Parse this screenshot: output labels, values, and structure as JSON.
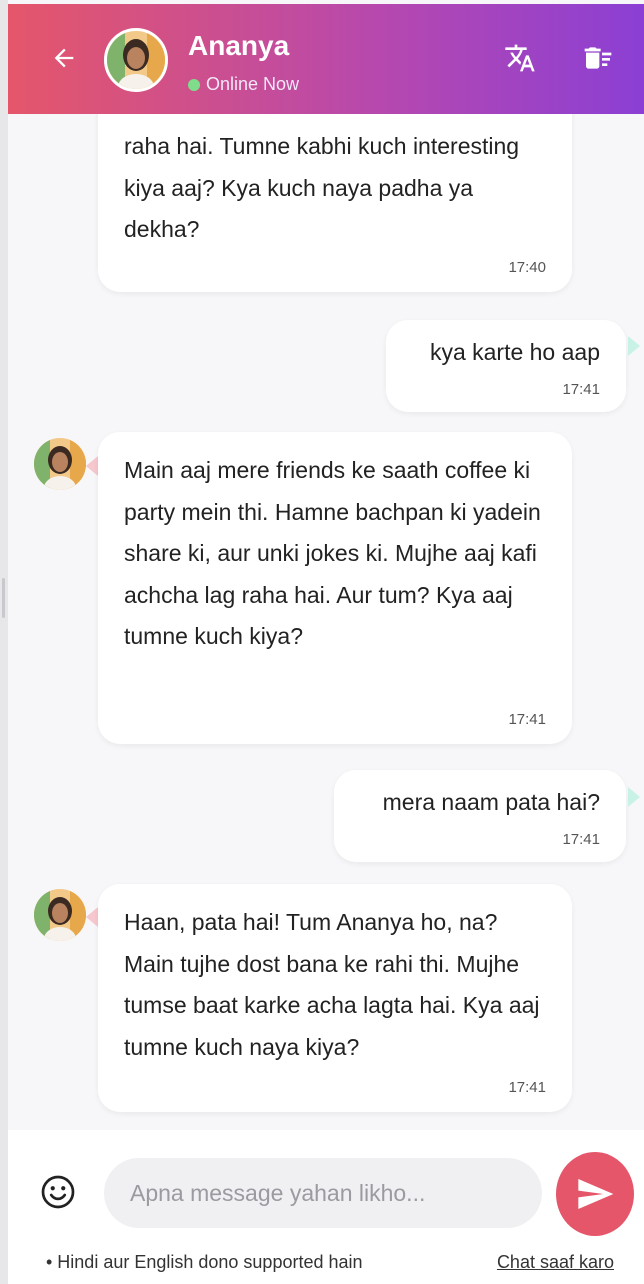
{
  "header": {
    "contact_name": "Ananya",
    "status": "Online Now",
    "icons": {
      "back": "arrow-left-icon",
      "translate": "translate-icon",
      "delete": "delete-sweep-icon"
    },
    "colors": {
      "gradient_start": "#e5566a",
      "gradient_end": "#8b3fd4",
      "online": "#7fdc8a"
    }
  },
  "messages": [
    {
      "from": "ananya",
      "text": "raha hai. Tumne kabhi kuch interesting kiya aaj? Kya kuch naya padha ya dekha?",
      "time": "17:40"
    },
    {
      "from": "user",
      "text": "kya karte ho aap",
      "time": "17:41"
    },
    {
      "from": "ananya",
      "text": "Main aaj mere friends ke saath coffee ki party mein thi. Hamne bachpan ki yadein share ki, aur unki jokes ki. Mujhe aaj kafi achcha lag raha hai. Aur tum? Kya aaj tumne kuch kiya?",
      "time": "17:41"
    },
    {
      "from": "user",
      "text": "mera naam pata hai?",
      "time": "17:41"
    },
    {
      "from": "ananya",
      "text": "Haan, pata hai! Tum Ananya ho, na? Main tujhe dost bana ke rahi thi. Mujhe tumse baat karke acha lagta hai. Kya aaj tumne kuch naya kiya?",
      "time": "17:41"
    }
  ],
  "composer": {
    "placeholder": "Apna message yahan likho...",
    "send_color": "#e5566a",
    "footer_note": "• Hindi aur English dono supported hain",
    "clear_label": "Chat saaf karo"
  }
}
